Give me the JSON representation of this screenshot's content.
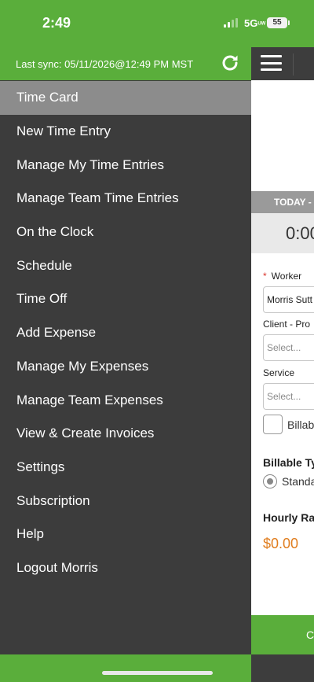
{
  "status_bar": {
    "time": "2:49",
    "network": "5G",
    "network_suffix": "UW",
    "battery": "55"
  },
  "drawer": {
    "last_sync": "Last sync: 05/11/2026@12:49 PM MST",
    "refresh_icon": "refresh-icon",
    "menu": [
      {
        "label": "Time Card",
        "active": true
      },
      {
        "label": "New Time Entry"
      },
      {
        "label": "Manage My Time Entries"
      },
      {
        "label": "Manage Team Time Entries"
      },
      {
        "label": "On the Clock"
      },
      {
        "label": "Schedule"
      },
      {
        "label": "Time Off"
      },
      {
        "label": "Add Expense"
      },
      {
        "label": "Manage My Expenses"
      },
      {
        "label": "Manage Team Expenses"
      },
      {
        "label": "View & Create Invoices"
      },
      {
        "label": "Settings"
      },
      {
        "label": "Subscription"
      },
      {
        "label": "Help"
      },
      {
        "label": "Logout Morris"
      }
    ]
  },
  "background_app": {
    "menu_icon": "hamburger-menu-icon",
    "today_label": "TODAY -",
    "timer": "0:00",
    "worker_label": "Worker",
    "worker_value": "Morris Sutt",
    "client_label": "Client - Pro",
    "client_placeholder": "Select...",
    "service_label": "Service",
    "service_placeholder": "Select...",
    "billable_label": "Billab",
    "billable_type_label": "Billable Ty",
    "standard_label": "Standa",
    "hourly_rate_label": "Hourly Ra",
    "hourly_rate_value": "$0.00",
    "bottom_button": "C"
  },
  "colors": {
    "brand_green": "#5aae3b",
    "drawer_bg": "#3c3c3c",
    "active_item": "#8c8c8c",
    "rate_orange": "#e07d1e",
    "required_red": "#d9342b"
  }
}
